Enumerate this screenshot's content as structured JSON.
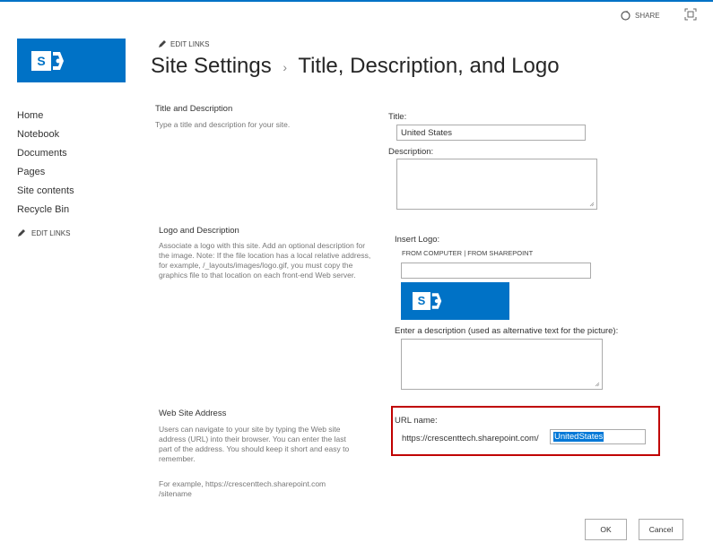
{
  "topbar": {
    "share_label": "SHARE",
    "share_icon": "sync-icon",
    "focus_icon": "focus-on-content-icon"
  },
  "header": {
    "edit_links": "EDIT LINKS",
    "breadcrumb_root": "Site Settings",
    "breadcrumb_sep": "›",
    "page_title": "Title, Description, and Logo"
  },
  "logo": {
    "letter": "S",
    "brand_color": "#0072c6"
  },
  "nav": {
    "items": [
      "Home",
      "Notebook",
      "Documents",
      "Pages",
      "Site contents",
      "Recycle Bin"
    ],
    "edit_links": "EDIT LINKS"
  },
  "title_section": {
    "heading": "Title and Description",
    "description": "Type a title and description for your site.",
    "title_label": "Title:",
    "title_value": "United States",
    "description_label": "Description:",
    "description_value": ""
  },
  "logo_section": {
    "heading": "Logo and Description",
    "description": "Associate a logo with this site. Add an optional description for the image. Note: If the file location has a local relative address, for example, /_layouts/images/logo.gif, you must copy the graphics file to that location on each front-end Web server.",
    "insert_label": "Insert Logo:",
    "from_computer": "FROM COMPUTER",
    "link_sep": "|",
    "from_sharepoint": "FROM SHAREPOINT",
    "logo_url_value": "",
    "alt_label": "Enter a description (used as alternative text for the picture):",
    "alt_value": ""
  },
  "url_section": {
    "heading": "Web Site Address",
    "description": "Users can navigate to your site by typing the Web site address (URL) into their browser. You can enter the last part of the address. You should keep it short and easy to remember.",
    "example": "For example, https://crescenttech.sharepoint.com /sitename",
    "url_label": "URL name:",
    "url_prefix": "https://crescenttech.sharepoint.com/",
    "url_value": "UnitedStates",
    "highlight_color": "#c00000"
  },
  "buttons": {
    "ok": "OK",
    "cancel": "Cancel"
  }
}
